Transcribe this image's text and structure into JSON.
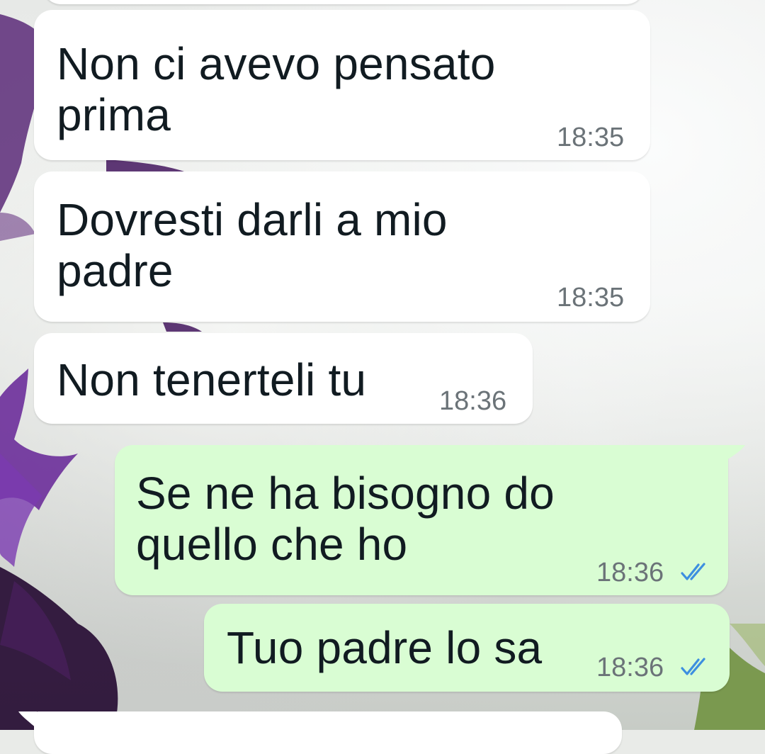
{
  "messages": [
    {
      "direction": "incoming",
      "text": "Non ci avevo pensato\nprima",
      "time": "18:35"
    },
    {
      "direction": "incoming",
      "text": "Dovresti darli a mio\npadre",
      "time": "18:35"
    },
    {
      "direction": "incoming",
      "text": "Non tenerteli tu",
      "time": "18:36"
    },
    {
      "direction": "outgoing",
      "text": "Se ne ha bisogno do\nquello che ho",
      "time": "18:36",
      "status": "read"
    },
    {
      "direction": "outgoing",
      "text": "Tuo padre lo sa",
      "time": "18:36",
      "status": "read"
    }
  ],
  "colors": {
    "incoming_bubble": "#ffffff",
    "outgoing_bubble": "#d9fdd3",
    "read_ticks": "#3d8fe0",
    "timestamp": "#6b7378",
    "text": "#111b21"
  },
  "icons": {
    "read_receipt": "double-check-icon"
  }
}
